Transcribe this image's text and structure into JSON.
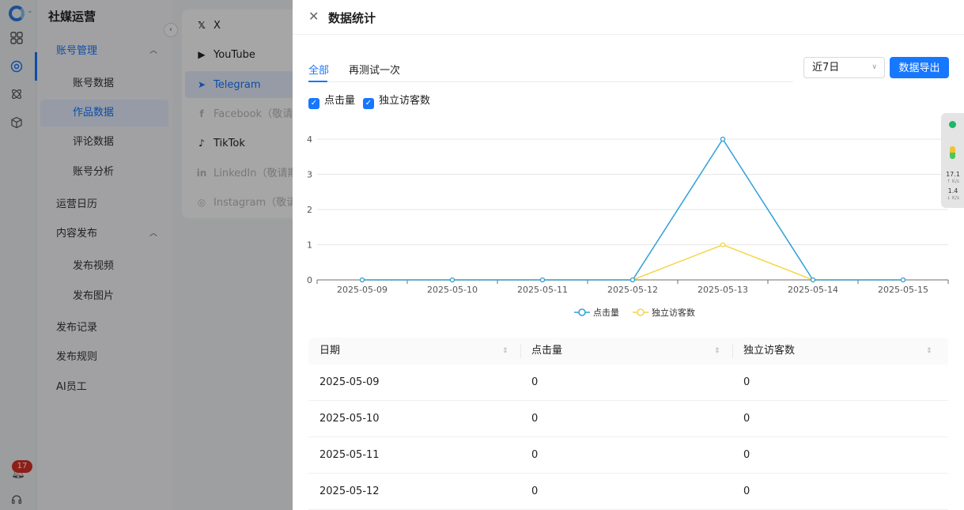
{
  "app": {
    "title": "社媒运营"
  },
  "rail": {
    "badge_count": "17"
  },
  "sidebar": {
    "items": [
      {
        "label": "账号管理",
        "type": "group",
        "expanded": true,
        "active": true
      },
      {
        "label": "账号数据",
        "type": "sub"
      },
      {
        "label": "作品数据",
        "type": "sub",
        "selected": true
      },
      {
        "label": "评论数据",
        "type": "sub"
      },
      {
        "label": "账号分析",
        "type": "sub"
      },
      {
        "label": "运营日历",
        "type": "item"
      },
      {
        "label": "内容发布",
        "type": "group",
        "expanded": true
      },
      {
        "label": "发布视频",
        "type": "sub"
      },
      {
        "label": "发布图片",
        "type": "sub"
      },
      {
        "label": "发布记录",
        "type": "item"
      },
      {
        "label": "发布规则",
        "type": "item"
      },
      {
        "label": "AI员工",
        "type": "item"
      }
    ]
  },
  "platforms": [
    {
      "label": "X",
      "icon": "x-logo-icon",
      "glyph": "𝕏"
    },
    {
      "label": "YouTube",
      "icon": "youtube-icon",
      "glyph": "▶"
    },
    {
      "label": "Telegram",
      "icon": "telegram-icon",
      "glyph": "➤",
      "selected": true
    },
    {
      "label": "Facebook（敬请期待）",
      "icon": "facebook-icon",
      "glyph": "f",
      "disabled": true
    },
    {
      "label": "TikTok",
      "icon": "tiktok-icon",
      "glyph": "♪"
    },
    {
      "label": "LinkedIn（敬请期待）",
      "icon": "linkedin-icon",
      "glyph": "in",
      "disabled": true
    },
    {
      "label": "Instagram（敬请期待）",
      "icon": "instagram-icon",
      "glyph": "◎",
      "disabled": true
    }
  ],
  "drawer": {
    "title": "数据统计",
    "tabs": [
      {
        "label": "全部",
        "active": true
      },
      {
        "label": "再测试一次"
      }
    ],
    "range_select": "近7日",
    "export_label": "数据导出",
    "checkboxes": [
      {
        "label": "点击量",
        "checked": true
      },
      {
        "label": "独立访客数",
        "checked": true
      }
    ]
  },
  "side_widget": {
    "up_speed": "17.1",
    "up_unit": "↑ K/s",
    "down_speed": "1.4",
    "down_unit": "↓ K/s"
  },
  "chart_data": {
    "type": "line",
    "x": [
      "2025-05-09",
      "2025-05-10",
      "2025-05-11",
      "2025-05-12",
      "2025-05-13",
      "2025-05-14",
      "2025-05-15"
    ],
    "series": [
      {
        "name": "点击量",
        "values": [
          0,
          0,
          0,
          0,
          4,
          0,
          0
        ],
        "color": "#2f9fd8"
      },
      {
        "name": "独立访客数",
        "values": [
          0,
          0,
          0,
          0,
          1,
          0,
          0
        ],
        "color": "#f5d547"
      }
    ],
    "yticks": [
      "0",
      "1",
      "2",
      "3",
      "4"
    ],
    "ylim": [
      0,
      4
    ],
    "grid": true,
    "legend": "bottom-center"
  },
  "table": {
    "columns": [
      "日期",
      "点击量",
      "独立访客数"
    ],
    "rows": [
      [
        "2025-05-09",
        "0",
        "0"
      ],
      [
        "2025-05-10",
        "0",
        "0"
      ],
      [
        "2025-05-11",
        "0",
        "0"
      ],
      [
        "2025-05-12",
        "0",
        "0"
      ]
    ]
  }
}
